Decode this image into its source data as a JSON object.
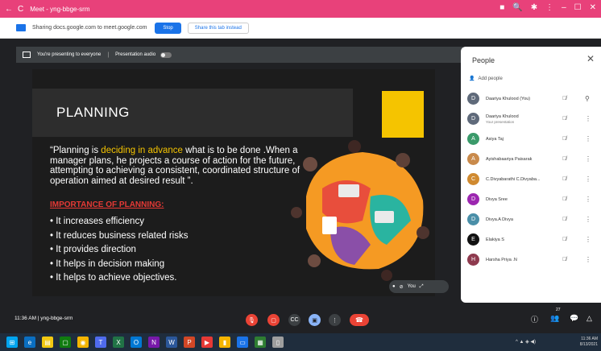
{
  "browser": {
    "title": "Meet - yng-bbge-srm"
  },
  "sharebar": {
    "text": "Sharing docs.google.com to meet.google.com",
    "stop_label": "Stop",
    "share_tab_label": "Share this tab instead"
  },
  "presenting": {
    "text": "You're presenting to everyone",
    "audio_label": "Presentation audio"
  },
  "slide": {
    "title": "PLANNING",
    "quote_pre": "“Planning is ",
    "quote_highlight": "deciding in advance",
    "quote_post": " what is to be done .When a manager plans, he projects a course of action for the future, attempting to achieving a consistent, coordinated structure of operation aimed at desired result ”.",
    "importance_heading": "IMPORTANCE OF PLANNING:",
    "bullets": [
      "• It increases efficiency",
      "• It reduces business related risks",
      "• It provides direction",
      "• It helps in decision making",
      "• It helps to achieve objectives."
    ],
    "you_label": "You"
  },
  "people": {
    "title": "People",
    "add_label": "Add people",
    "participants": [
      {
        "name": "Daariya Khulood (You)",
        "sub": "",
        "initial": "D",
        "color": "#5f6a7a"
      },
      {
        "name": "Daariya Khulood",
        "sub": "Your presentation",
        "initial": "D",
        "color": "#5f6a7a"
      },
      {
        "name": "Asiya Taj",
        "sub": "",
        "initial": "A",
        "color": "#3a9a6a"
      },
      {
        "name": "Ayishabaariya Paisarak",
        "sub": "",
        "initial": "A",
        "color": "#c98a4b"
      },
      {
        "name": "C.Divyabarathi C.Divyaba...",
        "sub": "",
        "initial": "C",
        "color": "#d08a30"
      },
      {
        "name": "Divya Sree",
        "sub": "",
        "initial": "D",
        "color": "#9c27b0"
      },
      {
        "name": "Divya.A Divya",
        "sub": "",
        "initial": "D",
        "color": "#4a8fa8"
      },
      {
        "name": "Elakiya S",
        "sub": "",
        "initial": "E",
        "color": "#111111"
      },
      {
        "name": "Harsha Priya .N",
        "sub": "",
        "initial": "H",
        "color": "#8e3a4e"
      }
    ]
  },
  "meeting": {
    "time": "11:36 AM",
    "code": "yng-bbge-srm",
    "participant_count": "27"
  },
  "taskbar": {
    "clock": "11:36 AM",
    "date": "8/13/2021"
  }
}
